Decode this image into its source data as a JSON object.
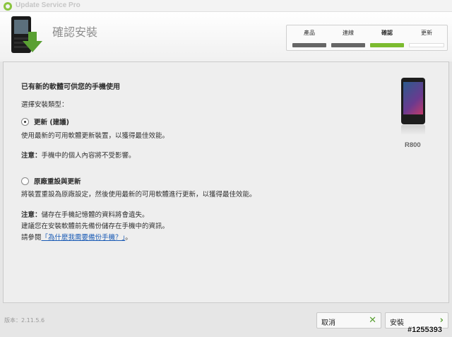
{
  "app": {
    "title": "Update Service Pro"
  },
  "header": {
    "title": "確認安裝",
    "steps": [
      {
        "label": "產品",
        "state": "done"
      },
      {
        "label": "連線",
        "state": "done"
      },
      {
        "label": "確認",
        "state": "active"
      },
      {
        "label": "更新",
        "state": "pending"
      }
    ]
  },
  "main": {
    "heading": "已有新的軟體可供您的手機使用",
    "select_type": "選擇安裝類型：",
    "option_update": {
      "label": "更新 (建議)",
      "selected": true,
      "description": "使用最新的可用軟體更新裝置，以獲得最佳效能。",
      "note_label": "注意：",
      "note_text": "手機中的個人內容將不受影響。"
    },
    "option_reset": {
      "label": "原廠重設與更新",
      "selected": false,
      "description": "將裝置重設為原廠設定，然後使用最新的可用軟體進行更新，以獲得最佳效能。",
      "note_label": "注意：",
      "note_text": "儲存在手機記憶體的資料將會遺失。",
      "advice": "建議您在安裝軟體前先備份儲存在手機中的資訊。",
      "see_prefix": "請參閱",
      "link_text": "「為什麼我需要備份手機？」",
      "see_suffix": "。"
    },
    "device_name": "R800"
  },
  "footer": {
    "version": "版本：2.11.5.6",
    "cancel_label": "取消",
    "install_label": "安裝"
  },
  "watermark": "#1255393",
  "colors": {
    "accent": "#7cbb2f",
    "link": "#1a5bb5"
  }
}
